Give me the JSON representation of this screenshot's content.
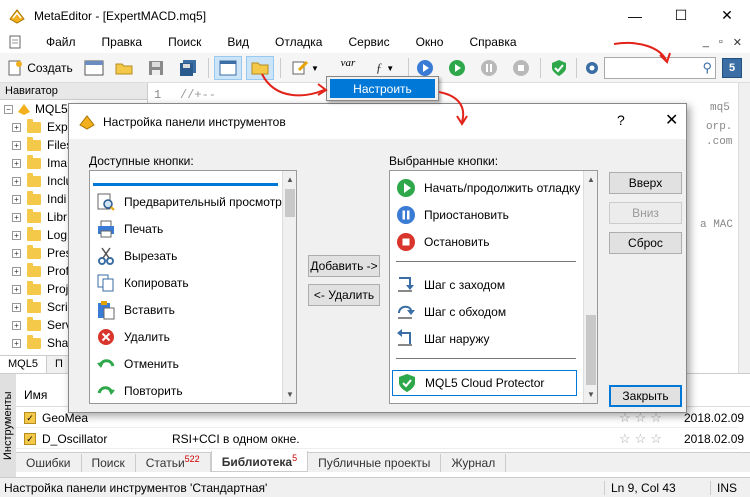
{
  "window": {
    "title": "MetaEditor - [ExpertMACD.mq5]",
    "minimize": "—",
    "maximize": "☐",
    "close": "✕"
  },
  "menu": {
    "items": [
      "Файл",
      "Правка",
      "Поиск",
      "Вид",
      "Отладка",
      "Сервис",
      "Окно",
      "Справка"
    ],
    "mdi": [
      "_",
      "▫",
      "✕"
    ]
  },
  "toolbar": {
    "new_label": "Создать",
    "var_label": "var",
    "search_value": "",
    "badge": "5"
  },
  "navigator": {
    "header": "Навигатор",
    "root": "MQL5",
    "items": [
      "Expe",
      "Files",
      "Ima",
      "Inclu",
      "Indi",
      "Libr",
      "Log",
      "Pres",
      "Prof",
      "Proj",
      "Scrip",
      "Serv",
      "Shar"
    ],
    "tabs": [
      "MQL5",
      "П"
    ]
  },
  "editor": {
    "line1_no": "1",
    "line1_code": "//+--",
    "right_snippets": [
      "mq5",
      "orp.",
      ".com",
      "a MAC"
    ]
  },
  "popup": {
    "item": "Настроить"
  },
  "dialog": {
    "title": "Настройка панели инструментов",
    "help": "?",
    "close": "✕",
    "available_label": "Доступные кнопки:",
    "selected_label": "Выбранные кнопки:",
    "available": [
      {
        "icon": "print-preview-icon",
        "label": "Предварительный просмотр"
      },
      {
        "icon": "print-icon",
        "label": "Печать"
      },
      {
        "icon": "cut-icon",
        "label": "Вырезать"
      },
      {
        "icon": "copy-icon",
        "label": "Копировать"
      },
      {
        "icon": "paste-icon",
        "label": "Вставить"
      },
      {
        "icon": "delete-icon",
        "label": "Удалить"
      },
      {
        "icon": "undo-icon",
        "label": "Отменить"
      },
      {
        "icon": "redo-icon",
        "label": "Повторить"
      }
    ],
    "selected": [
      {
        "icon": "play-icon",
        "label": "Начать/продолжить отладку"
      },
      {
        "icon": "pause-icon",
        "label": "Приостановить"
      },
      {
        "icon": "stop-icon",
        "label": "Остановить"
      },
      {
        "icon": "step-into-icon",
        "label": "Шаг с заходом"
      },
      {
        "icon": "step-over-icon",
        "label": "Шаг с обходом"
      },
      {
        "icon": "step-out-icon",
        "label": "Шаг наружу"
      },
      {
        "icon": "cloud-protector-icon",
        "label": "MQL5 Cloud Protector"
      }
    ],
    "add_button": "Добавить ->",
    "remove_button": "<- Удалить",
    "up_button": "Вверх",
    "down_button": "Вниз",
    "reset_button": "Сброс",
    "close_button": "Закрыть"
  },
  "library": {
    "side_label": "Инструменты",
    "col_name": "Имя",
    "rows": [
      {
        "name": "GeoMea",
        "desc": "",
        "date": "2018.02.09"
      },
      {
        "name": "D_Oscillator",
        "desc": "RSI+CCI в одном окне.",
        "date": "2018.02.09"
      }
    ],
    "tabs": [
      {
        "label": "Ошибки",
        "count": ""
      },
      {
        "label": "Поиск",
        "count": ""
      },
      {
        "label": "Статьи",
        "count": "522"
      },
      {
        "label": "Библиотека",
        "count": "5"
      },
      {
        "label": "Публичные проекты",
        "count": ""
      },
      {
        "label": "Журнал",
        "count": ""
      }
    ]
  },
  "status": {
    "message": "Настройка панели инструментов 'Стандартная'",
    "position": "Ln 9, Col 43",
    "mode": "INS"
  },
  "colors": {
    "accent": "#0078d7",
    "arrow": "#e2231a",
    "folder": "#f4c94a"
  }
}
